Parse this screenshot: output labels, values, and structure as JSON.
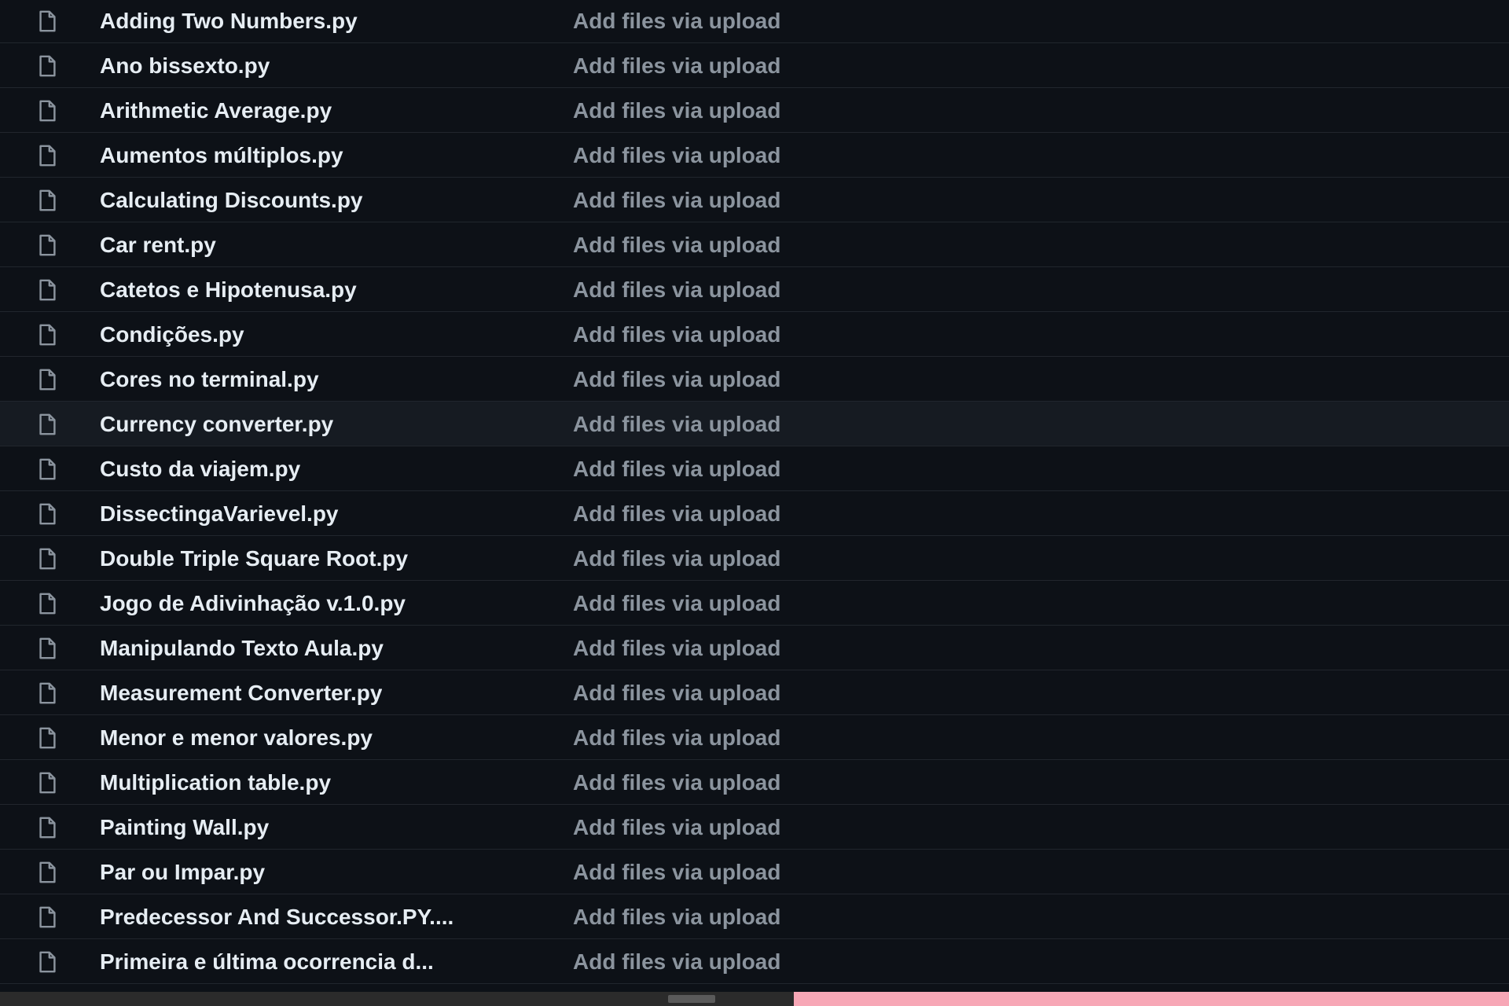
{
  "colors": {
    "background": "#0d1117",
    "row_hover_background": "#161b22",
    "row_divider": "#21262d",
    "file_name": "#e6edf3",
    "commit_message": "#8b949e",
    "file_icon": "#8b949e"
  },
  "file_list": {
    "hovered_index": 9,
    "rows": [
      {
        "name": "Adding Two Numbers.py",
        "commit": "Add files via upload"
      },
      {
        "name": "Ano bissexto.py",
        "commit": "Add files via upload"
      },
      {
        "name": "Arithmetic Average.py",
        "commit": "Add files via upload"
      },
      {
        "name": "Aumentos múltiplos.py",
        "commit": "Add files via upload"
      },
      {
        "name": "Calculating Discounts.py",
        "commit": "Add files via upload"
      },
      {
        "name": "Car rent.py",
        "commit": "Add files via upload"
      },
      {
        "name": "Catetos e Hipotenusa.py",
        "commit": "Add files via upload"
      },
      {
        "name": "Condições.py",
        "commit": "Add files via upload"
      },
      {
        "name": "Cores no terminal.py",
        "commit": "Add files via upload"
      },
      {
        "name": "Currency converter.py",
        "commit": "Add files via upload"
      },
      {
        "name": "Custo da viajem.py",
        "commit": "Add files via upload"
      },
      {
        "name": "DissectingaVarievel.py",
        "commit": "Add files via upload"
      },
      {
        "name": "Double Triple Square Root.py",
        "commit": "Add files via upload"
      },
      {
        "name": "Jogo de Adivinhação v.1.0.py",
        "commit": "Add files via upload"
      },
      {
        "name": "Manipulando Texto Aula.py",
        "commit": "Add files via upload"
      },
      {
        "name": "Measurement Converter.py",
        "commit": "Add files via upload"
      },
      {
        "name": "Menor e menor valores.py",
        "commit": "Add files via upload"
      },
      {
        "name": "Multiplication table.py",
        "commit": "Add files via upload"
      },
      {
        "name": "Painting Wall.py",
        "commit": "Add files via upload"
      },
      {
        "name": "Par ou Impar.py",
        "commit": "Add files via upload"
      },
      {
        "name": "Predecessor And Successor.PY....",
        "commit": "Add files via upload"
      },
      {
        "name": "Primeira e última ocorrencia d...",
        "commit": "Add files via upload"
      }
    ]
  }
}
